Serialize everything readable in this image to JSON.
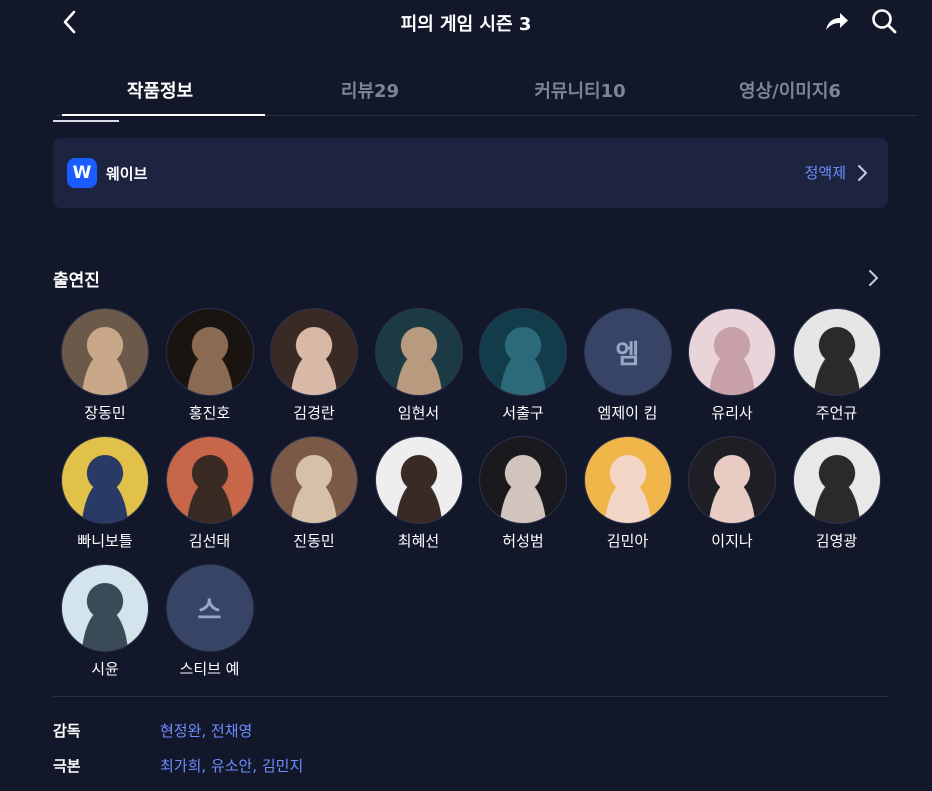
{
  "header": {
    "title": "피의 게임 시즌 3"
  },
  "tabs": [
    {
      "label": "작품정보",
      "active": true
    },
    {
      "label": "리뷰29",
      "active": false
    },
    {
      "label": "커뮤니티10",
      "active": false
    },
    {
      "label": "영상/이미지6",
      "active": false
    }
  ],
  "platform": {
    "logo_letter": "W",
    "name": "웨이브",
    "plan": "정액제",
    "brand_color": "#1a5cff"
  },
  "cast_section": {
    "title": "출연진",
    "members": [
      {
        "name": "장동민",
        "initial": null,
        "colors": [
          "#6b5a4a",
          "#c9a889"
        ]
      },
      {
        "name": "홍진호",
        "initial": null,
        "colors": [
          "#1a1410",
          "#8a6a52"
        ]
      },
      {
        "name": "김경란",
        "initial": null,
        "colors": [
          "#3a2a26",
          "#d8b8a6"
        ]
      },
      {
        "name": "임현서",
        "initial": null,
        "colors": [
          "#1c3a44",
          "#b89a7e"
        ]
      },
      {
        "name": "서출구",
        "initial": null,
        "colors": [
          "#123c4a",
          "#2c6a7a"
        ]
      },
      {
        "name": "엠제이 킴",
        "initial": "엠",
        "colors": null
      },
      {
        "name": "유리사",
        "initial": null,
        "colors": [
          "#e9d5d9",
          "#c7a0a8"
        ]
      },
      {
        "name": "주언규",
        "initial": null,
        "colors": [
          "#e6e6e6",
          "#2a2a2a"
        ]
      },
      {
        "name": "빠니보틀",
        "initial": null,
        "colors": [
          "#e2c14a",
          "#2a3a66"
        ]
      },
      {
        "name": "김선태",
        "initial": null,
        "colors": [
          "#c8664a",
          "#3a2a24"
        ]
      },
      {
        "name": "진동민",
        "initial": null,
        "colors": [
          "#7a5a46",
          "#d6c0a8"
        ]
      },
      {
        "name": "최혜선",
        "initial": null,
        "colors": [
          "#eeeeee",
          "#3a2a26"
        ]
      },
      {
        "name": "허성범",
        "initial": null,
        "colors": [
          "#1a1a1e",
          "#d0c4bc"
        ]
      },
      {
        "name": "김민아",
        "initial": null,
        "colors": [
          "#f0b64a",
          "#f4d6c6"
        ]
      },
      {
        "name": "이지나",
        "initial": null,
        "colors": [
          "#1e1e24",
          "#e8ccc4"
        ]
      },
      {
        "name": "김영광",
        "initial": null,
        "colors": [
          "#e8e8e8",
          "#2a2a2a"
        ]
      },
      {
        "name": "시윤",
        "initial": null,
        "colors": [
          "#d4e4ec",
          "#3a4a56"
        ]
      },
      {
        "name": "스티브 예",
        "initial": "스",
        "colors": null
      }
    ]
  },
  "credits": [
    {
      "label": "감독",
      "value": "현정완, 전채영"
    },
    {
      "label": "극본",
      "value": "최가희, 유소안, 김민지"
    }
  ],
  "colors": {
    "background": "#12172a",
    "card": "#1c2440",
    "accent": "#6f8cff"
  },
  "icons": {
    "back": "chevron-left-icon",
    "share": "share-icon",
    "search": "search-icon",
    "chevron": "chevron-right-icon"
  }
}
